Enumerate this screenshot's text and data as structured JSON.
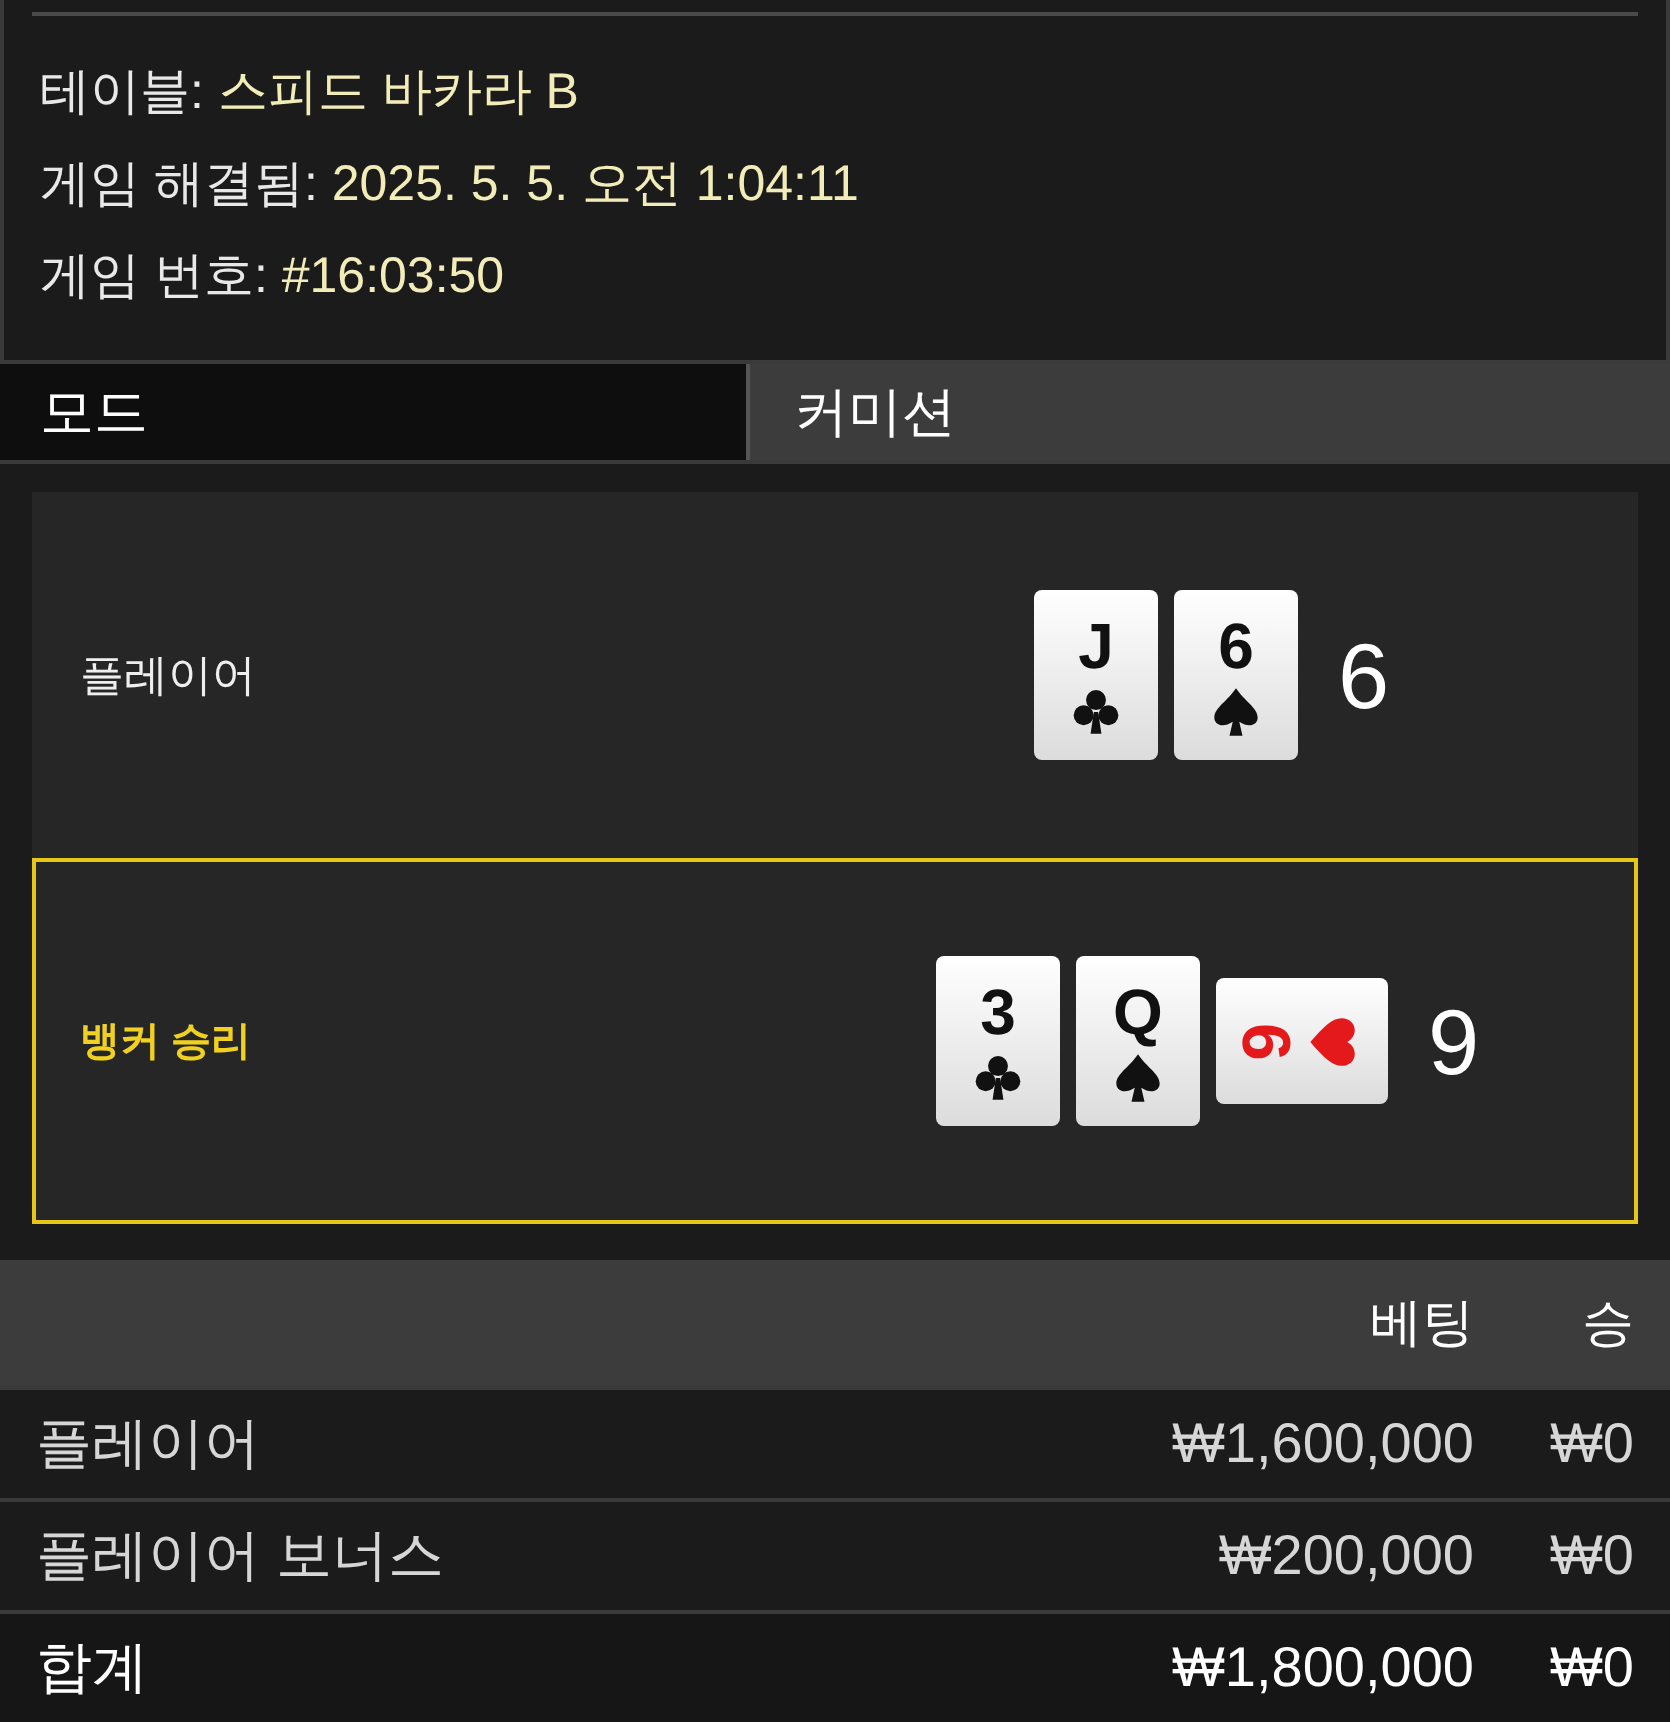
{
  "info": [
    {
      "label": "테이블:",
      "value": "스피드 바카라 B"
    },
    {
      "label": "게임 해결됨:",
      "value": "2025. 5. 5. 오전 1:04:11"
    },
    {
      "label": "게임 번호:",
      "value": "#16:03:50"
    }
  ],
  "mode": {
    "label": "모드",
    "value": "커미션"
  },
  "hands": [
    {
      "label": "플레이어",
      "winner": false,
      "total": "6",
      "cards": [
        {
          "rank": "J",
          "kind": "club",
          "sideways": false
        },
        {
          "rank": "6",
          "kind": "spade",
          "sideways": false
        }
      ]
    },
    {
      "label": "뱅커 승리",
      "winner": true,
      "total": "9",
      "cards": [
        {
          "rank": "3",
          "kind": "club",
          "sideways": false
        },
        {
          "rank": "Q",
          "kind": "spade",
          "sideways": false
        },
        {
          "rank": "6",
          "kind": "heart",
          "sideways": true
        }
      ]
    }
  ],
  "table": {
    "columns": [
      "",
      "베팅",
      "승"
    ],
    "rows": [
      {
        "kind": "bet",
        "cells": [
          "플레이어",
          "₩1,600,000",
          "₩0"
        ]
      },
      {
        "kind": "bet",
        "cells": [
          "플레이어 보너스",
          "₩200,000",
          "₩0"
        ]
      },
      {
        "kind": "total",
        "cells": [
          "합계",
          "₩1,800,000",
          "₩0"
        ]
      }
    ]
  }
}
